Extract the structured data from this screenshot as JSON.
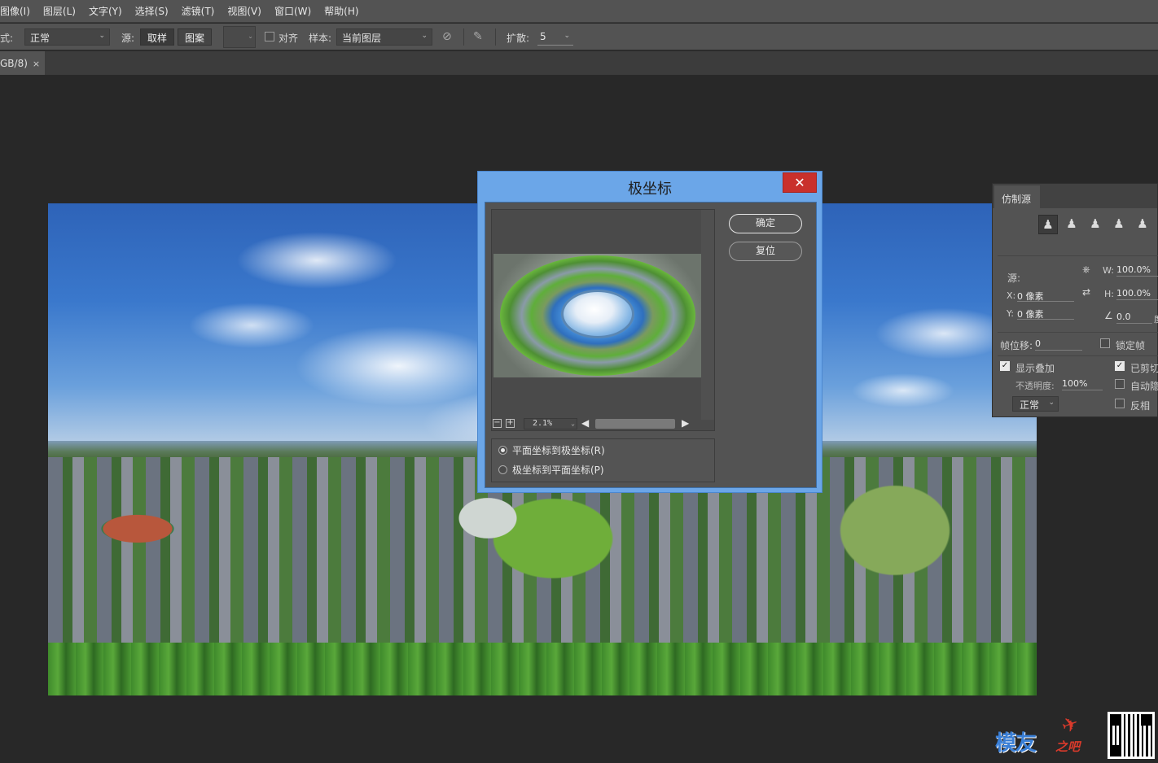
{
  "menu": [
    "图像(I)",
    "图层(L)",
    "文字(Y)",
    "选择(S)",
    "滤镜(T)",
    "视图(V)",
    "窗口(W)",
    "帮助(H)"
  ],
  "options": {
    "mode_label": "模式:",
    "mode_value": "正常",
    "source_label": "源:",
    "source_sampled": "取样",
    "source_pattern": "图案",
    "aligned_label": "对齐",
    "sample_label": "样本:",
    "sample_value": "当前图层",
    "diffusion_label": "扩散:",
    "diffusion_value": "5"
  },
  "document": {
    "tab_label": "GB/8)",
    "tab_close": "×"
  },
  "dialog": {
    "title": "极坐标",
    "close": "✕",
    "ok_label": "确定",
    "reset_label": "复位",
    "zoom_value": "2.1%",
    "zoom_out": "−",
    "zoom_in": "+",
    "option_rect_to_polar": "平面坐标到极坐标(R)",
    "option_polar_to_rect": "极坐标到平面坐标(P)",
    "selected_option": "rect_to_polar"
  },
  "clone_panel": {
    "tab": "仿制源",
    "source_label": "源:",
    "x_label": "X:",
    "x_value": "0 像素",
    "y_label": "Y:",
    "y_value": "0 像素",
    "w_label": "W:",
    "w_value": "100.0%",
    "h_label": "H:",
    "h_value": "100.0%",
    "angle_value": "0.0",
    "angle_unit": "度",
    "frame_offset_label": "帧位移:",
    "frame_offset_value": "0",
    "lock_frame_label": "锁定帧",
    "show_overlay_label": "显示叠加",
    "clipped_label": "已剪切",
    "opacity_label": "不透明度:",
    "opacity_value": "100%",
    "auto_hide_label": "自动隐藏",
    "invert_label": "反相",
    "blend_value": "正常"
  },
  "watermark": {
    "text": "模友",
    "sub": "之吧"
  }
}
